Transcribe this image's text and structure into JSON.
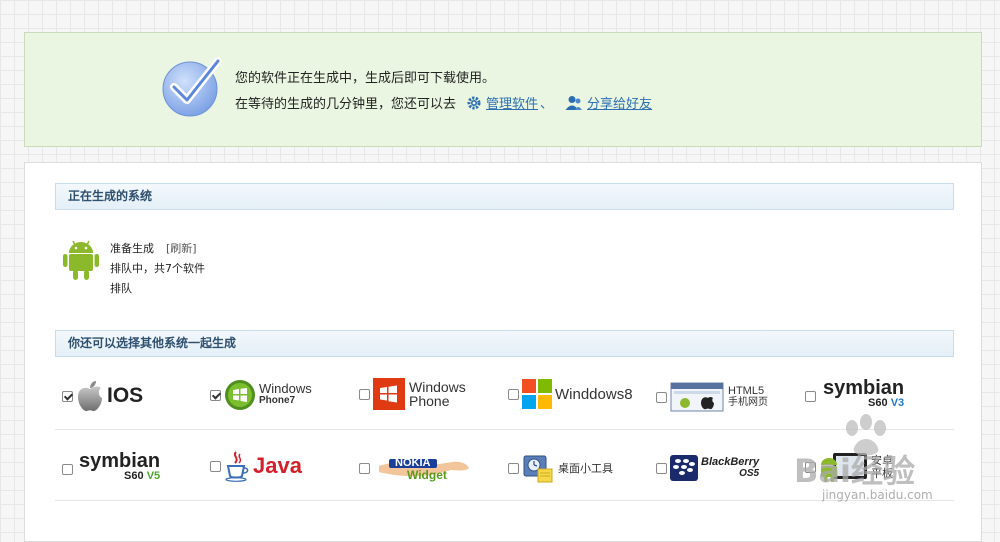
{
  "notice": {
    "line1": "您的软件正在生成中，生成后即可下载使用。",
    "line2_prefix": "在等待的生成的几分钟里，您还可以去",
    "manage_link": "管理软件",
    "separator": "、",
    "share_link": "分享给好友"
  },
  "generating": {
    "title": "正在生成的系统",
    "status": "准备生成",
    "refresh": "[刷新]",
    "queue": "排队中，共7个软件",
    "state": "排队"
  },
  "others": {
    "title": "你还可以选择其他系统一起生成",
    "platforms": [
      {
        "name": "ios",
        "text": "IOS",
        "checked": true
      },
      {
        "name": "windows-phone7",
        "text1": "Windows",
        "text2": "Phone7",
        "checked": true
      },
      {
        "name": "windows-phone",
        "text1": "Windows",
        "text2": "Phone",
        "checked": false
      },
      {
        "name": "windows8",
        "text": "Winddows8",
        "checked": false
      },
      {
        "name": "html5",
        "text1": "HTML5",
        "text2": "手机网页",
        "checked": false
      },
      {
        "name": "symbian-v3",
        "text1": "symbian",
        "text2": "S60",
        "text3": "V3",
        "checked": false
      },
      {
        "name": "symbian-v5",
        "text1": "symbian",
        "text2": "S60",
        "text3": "V5",
        "checked": false
      },
      {
        "name": "java",
        "text": "Java",
        "checked": false
      },
      {
        "name": "nokia-widget",
        "text1": "NOKIA",
        "text2": "Widget",
        "checked": false
      },
      {
        "name": "desktop-widget",
        "text": "桌面小工具",
        "checked": false
      },
      {
        "name": "blackberry",
        "text1": "BlackBerry",
        "text2": "OS5",
        "checked": false
      },
      {
        "name": "android-tablet",
        "text1": "安卓",
        "text2": "平板",
        "checked": false
      }
    ]
  },
  "watermark": {
    "brand": "Bai经验",
    "url": "jingyan.baidu.com"
  },
  "colors": {
    "accent": "#2b6fb1",
    "android": "#8cb82c",
    "notice_bg": "#eaf5e2",
    "symbian_green": "#4aa82a",
    "symbian_blue": "#1f77c9",
    "java_red": "#d4202a"
  }
}
